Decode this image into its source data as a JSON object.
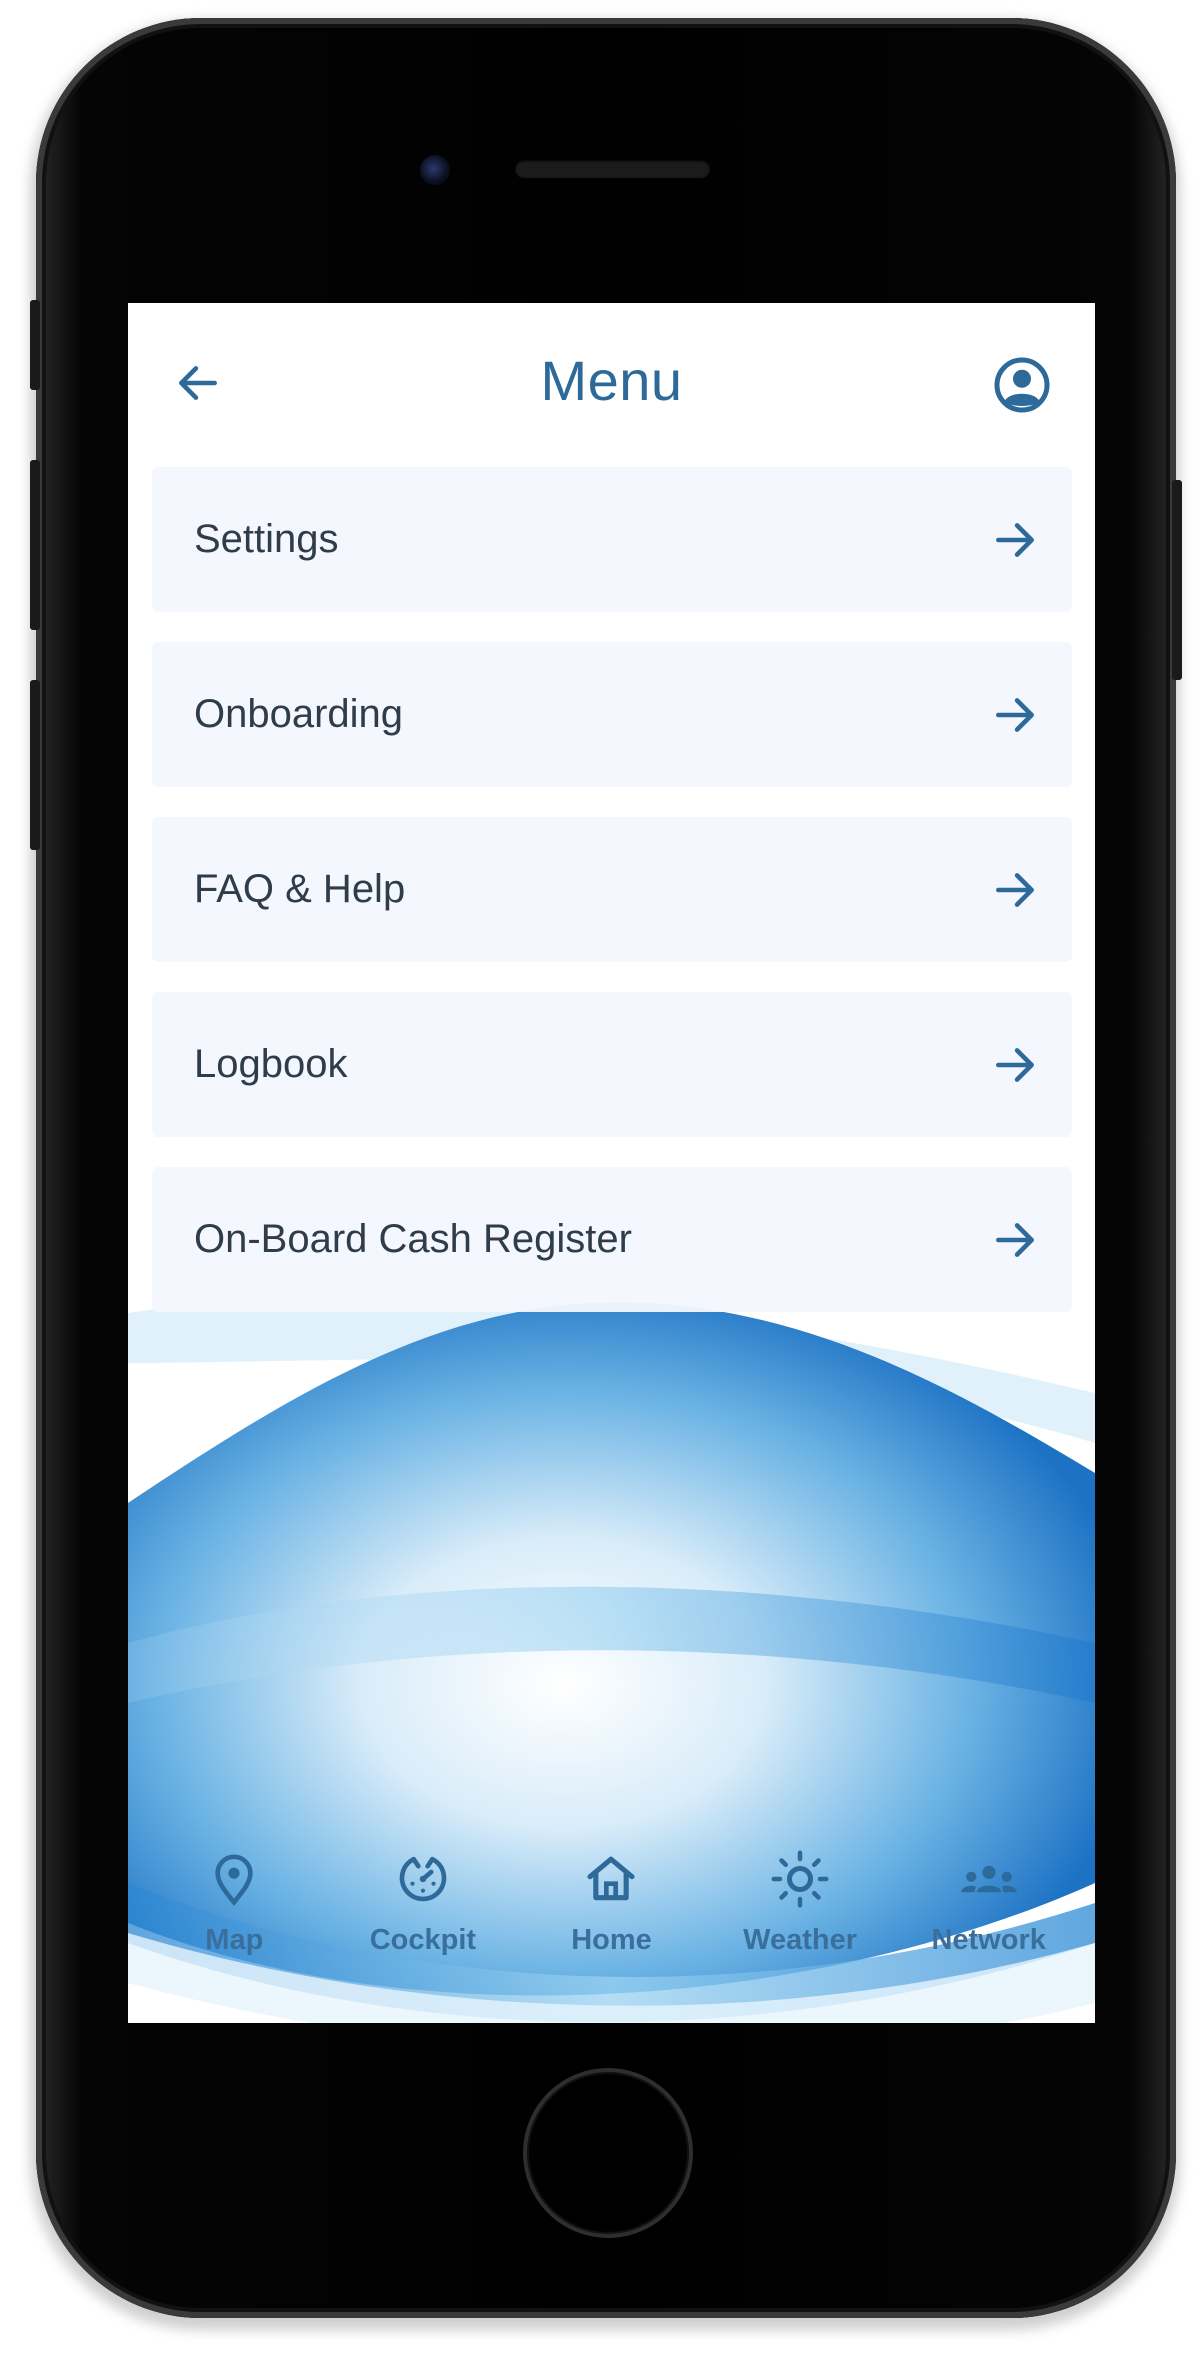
{
  "header": {
    "title": "Menu",
    "back_icon": "arrow-left-icon",
    "profile_icon": "account-circle-icon"
  },
  "menu": {
    "items": [
      {
        "label": "Settings",
        "icon": "arrow-right-icon"
      },
      {
        "label": "Onboarding",
        "icon": "arrow-right-icon"
      },
      {
        "label": "FAQ & Help",
        "icon": "arrow-right-icon"
      },
      {
        "label": "Logbook",
        "icon": "arrow-right-icon"
      },
      {
        "label": "On-Board Cash Register",
        "icon": "arrow-right-icon"
      }
    ]
  },
  "bottom_nav": {
    "items": [
      {
        "label": "Map",
        "icon": "map-pin-icon"
      },
      {
        "label": "Cockpit",
        "icon": "cockpit-icon"
      },
      {
        "label": "Home",
        "icon": "home-icon"
      },
      {
        "label": "Weather",
        "icon": "sun-icon"
      },
      {
        "label": "Network",
        "icon": "people-icon"
      }
    ]
  },
  "colors": {
    "accent": "#2d6a9a",
    "item_background": "#f4f7fd",
    "item_text": "#2f3d4a",
    "wave_blue": "#1e7fd0"
  }
}
